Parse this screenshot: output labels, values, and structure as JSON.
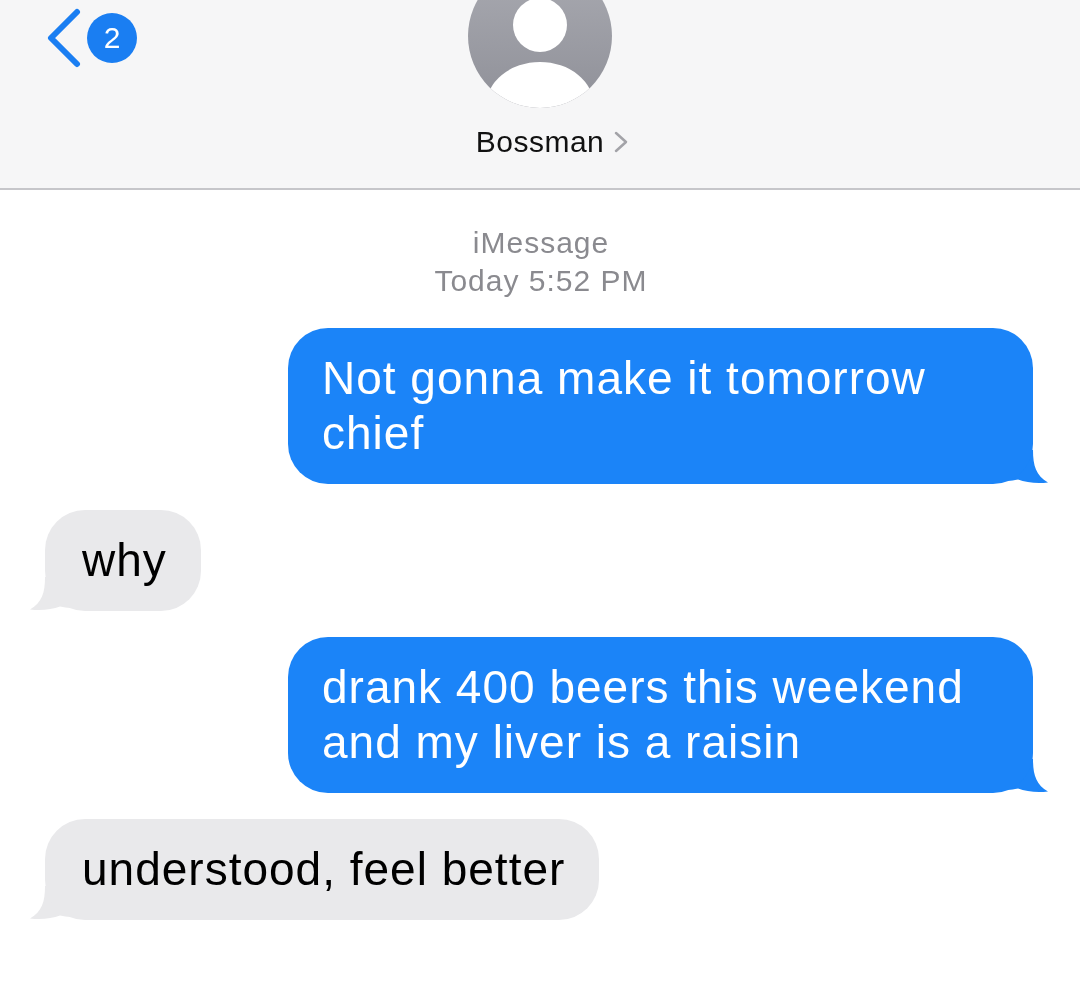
{
  "header": {
    "back_badge": "2",
    "contact_name": "Bossman"
  },
  "thread": {
    "service": "iMessage",
    "timestamp": "Today 5:52 PM",
    "messages": [
      {
        "kind": "sent",
        "text": "Not gonna make it tomorrow chief"
      },
      {
        "kind": "received",
        "text": "why"
      },
      {
        "kind": "sent",
        "text": "drank 400 beers this weekend and my liver is a raisin"
      },
      {
        "kind": "received",
        "text": "understood, feel better"
      }
    ]
  }
}
